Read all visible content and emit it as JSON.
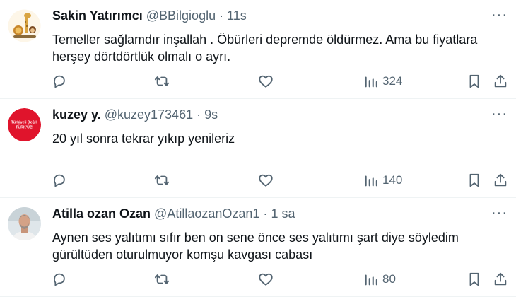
{
  "tweets": [
    {
      "name": "Sakin Yatırımcı",
      "handle": "@BBilgioglu",
      "dot": "·",
      "time": "11s",
      "text_lines": [
        "Temeller sağlamdır inşallah . Öbürleri depremde öldürmez. Ama bu fiyatlara",
        "herşey dörtdörtlük olmalı o ayrı."
      ],
      "views": "324",
      "avatar": "cartoon-animals"
    },
    {
      "name": "kuzey y.",
      "handle": "@kuzey173461",
      "dot": "·",
      "time": "9s",
      "text_lines": [
        "20 yıl sonra tekrar yıkıp yenileriz"
      ],
      "views": "140",
      "avatar_text": [
        "Türkiyeli Değil,",
        "TÜRK'ÜZ!"
      ],
      "avatar_color": "#e0142c"
    },
    {
      "name": "Atilla ozan Ozan",
      "handle": "@AtillaozanOzan1",
      "dot": "·",
      "time": "1 sa",
      "text_lines": [
        "Aynen ses yalıtımı sıfır ben on sene önce ses yalıtımı şart diye söyledim",
        "gürültüden oturulmuyor komşu kavgası cabası"
      ],
      "views": "80",
      "avatar": "man-photo"
    }
  ],
  "more_glyph": "···"
}
